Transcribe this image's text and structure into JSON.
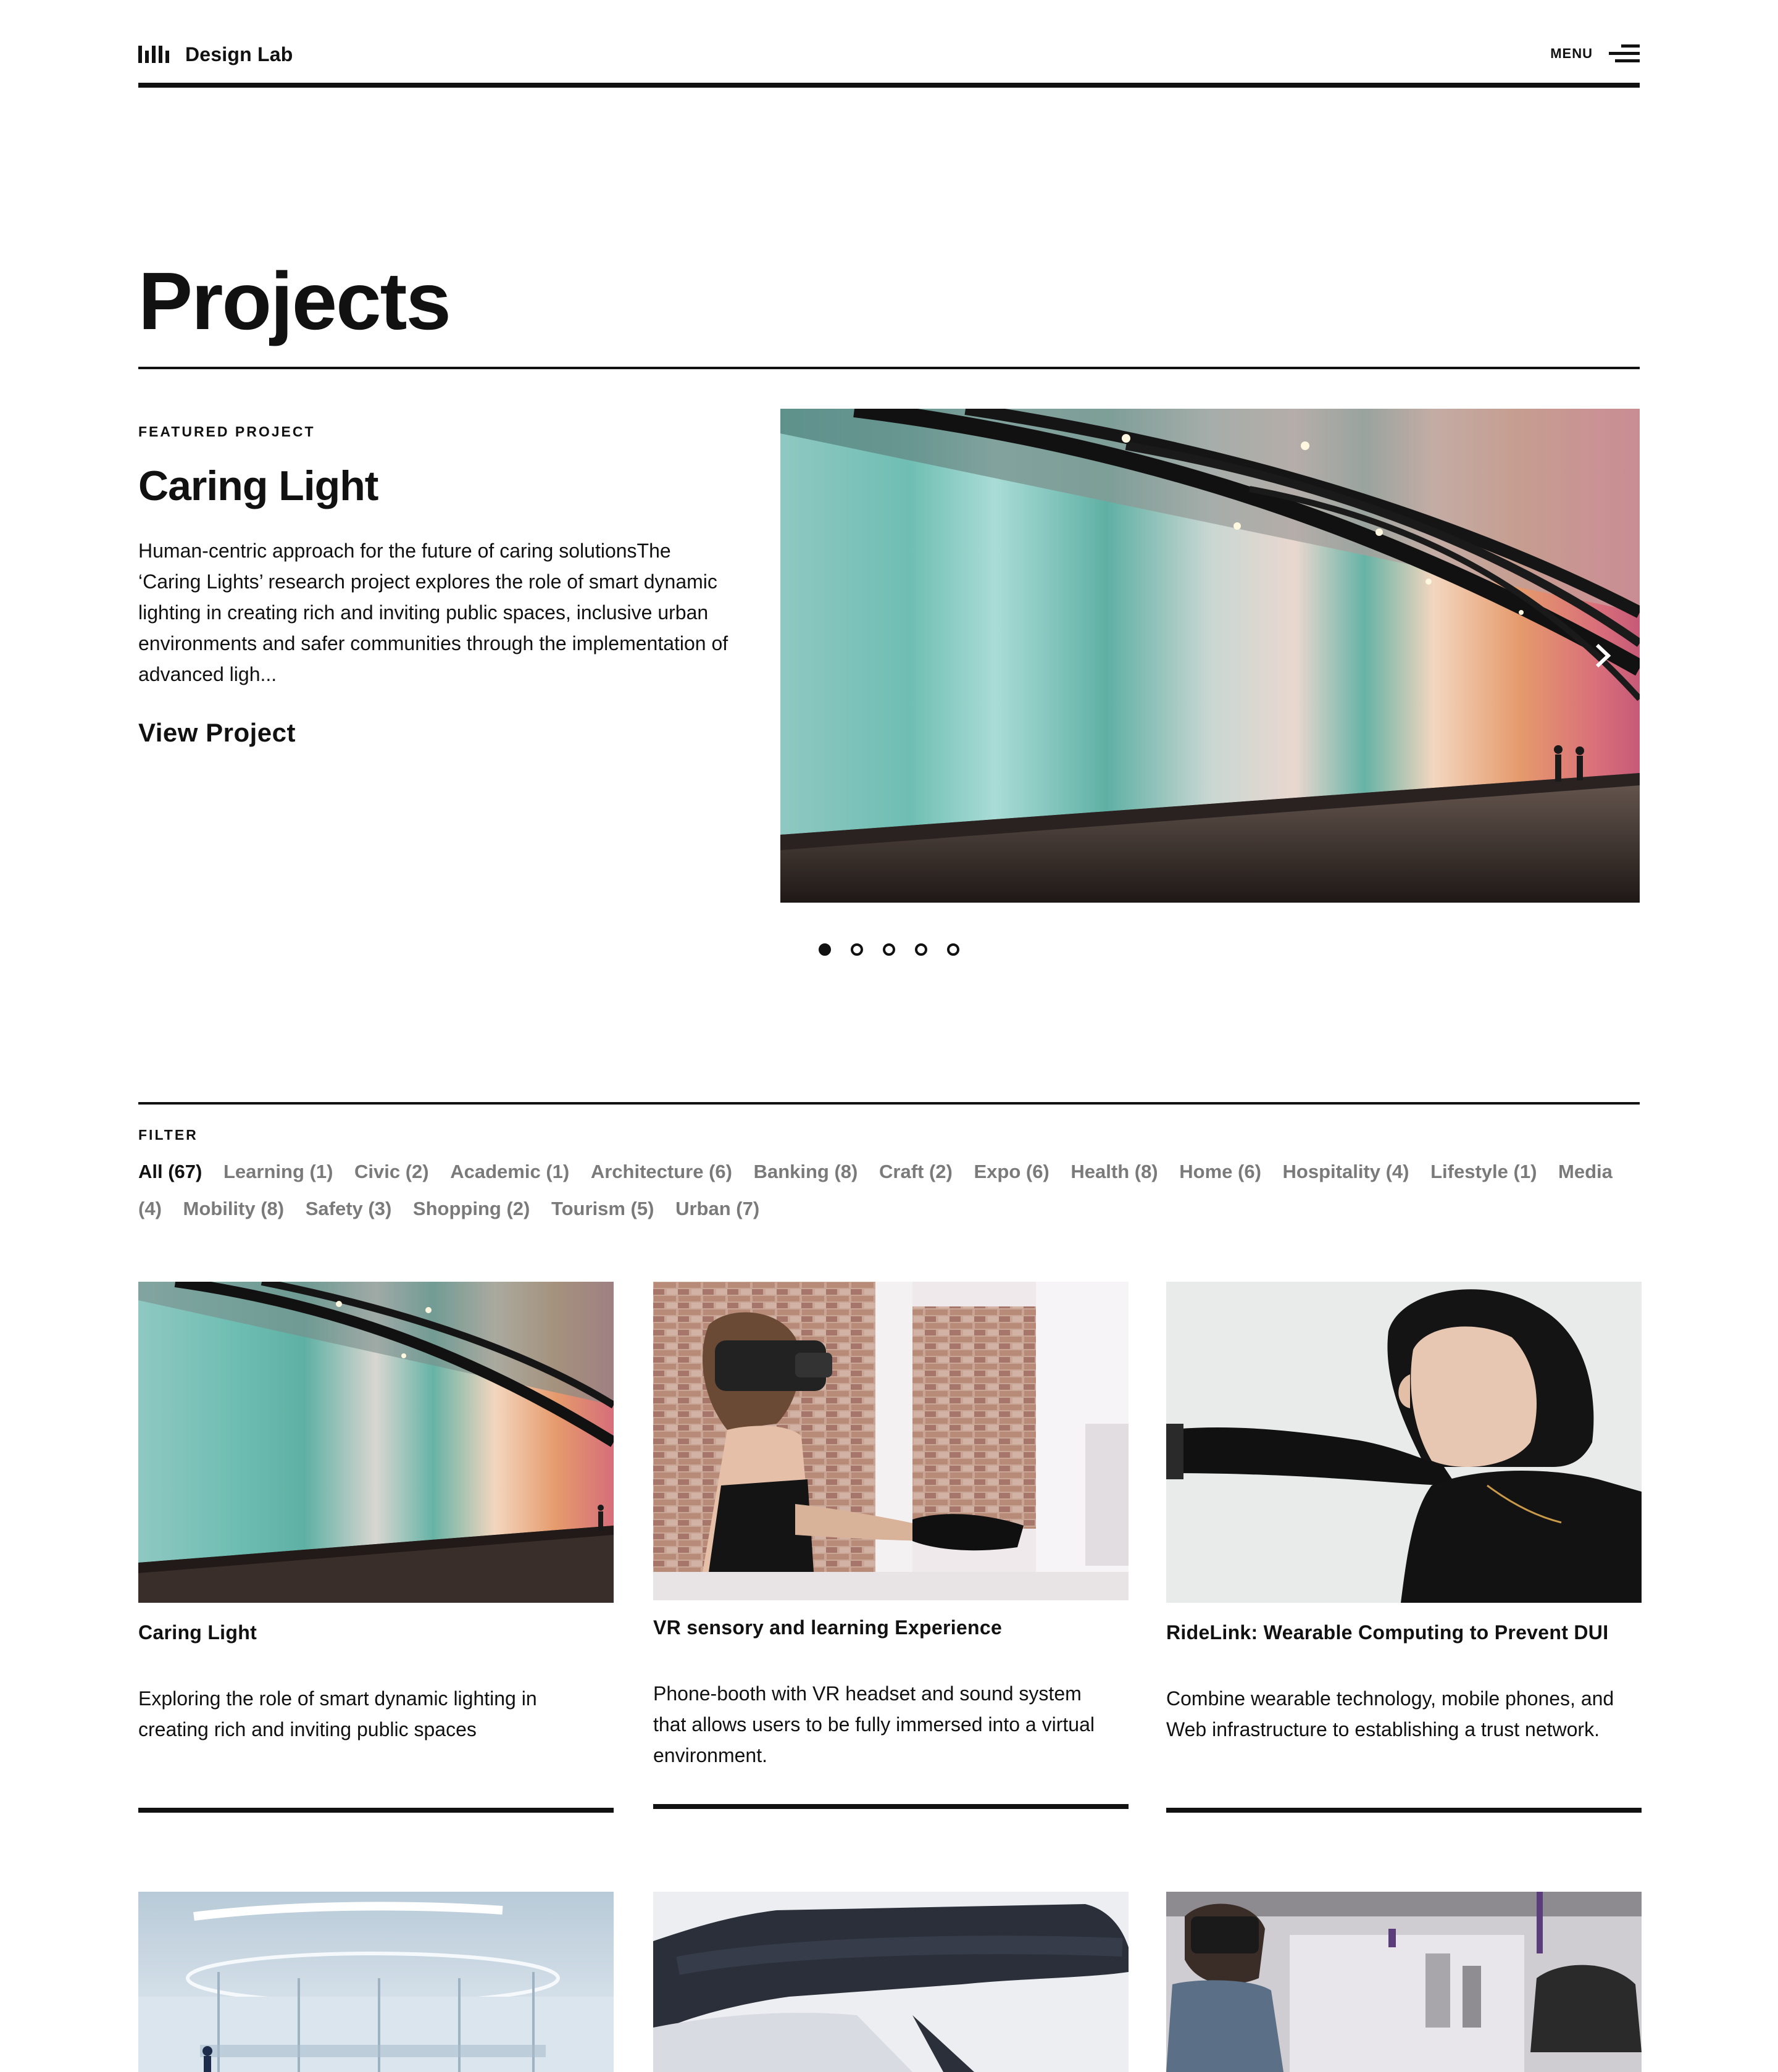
{
  "header": {
    "brand": "Design Lab",
    "menu_label": "MENU"
  },
  "page": {
    "title": "Projects"
  },
  "featured": {
    "eyebrow": "FEATURED PROJECT",
    "title": "Caring Light",
    "description": "Human-centric approach for the future of caring solutionsThe ‘Caring Lights’ research project explores the role of smart dynamic lighting in creating rich and inviting public spaces, inclusive urban environments and safer communities through the implementation of advanced ligh...",
    "link_label": "View Project",
    "slides": 5,
    "active_slide": 1
  },
  "filter": {
    "label": "FILTER",
    "items": [
      {
        "label": "All (67)",
        "active": true
      },
      {
        "label": "Learning (1)"
      },
      {
        "label": "Civic (2)"
      },
      {
        "label": "Academic (1)"
      },
      {
        "label": "Architecture (6)"
      },
      {
        "label": "Banking (8)"
      },
      {
        "label": "Craft (2)"
      },
      {
        "label": "Expo (6)"
      },
      {
        "label": "Health (8)"
      },
      {
        "label": "Home (6)"
      },
      {
        "label": "Hospitality (4)"
      },
      {
        "label": "Lifestyle (1)"
      },
      {
        "label": "Media (4)"
      },
      {
        "label": "Mobility (8)"
      },
      {
        "label": "Safety (3)"
      },
      {
        "label": "Shopping (2)"
      },
      {
        "label": "Tourism (5)"
      },
      {
        "label": "Urban (7)"
      }
    ]
  },
  "cards": [
    {
      "title": "Caring Light",
      "description": "Exploring the role of smart dynamic lighting in creating rich and inviting public spaces"
    },
    {
      "title": "VR sensory and learning Experience",
      "description": "Phone-booth with VR headset and sound system that allows users to be fully immersed into a virtual environment."
    },
    {
      "title": "RideLink: Wearable Computing to Prevent DUI",
      "description": "Combine wearable technology, mobile phones, and Web infrastructure to establishing a trust network."
    }
  ],
  "colors": {
    "ink": "#111111",
    "muted": "#7a7a7a",
    "background": "#ffffff"
  }
}
